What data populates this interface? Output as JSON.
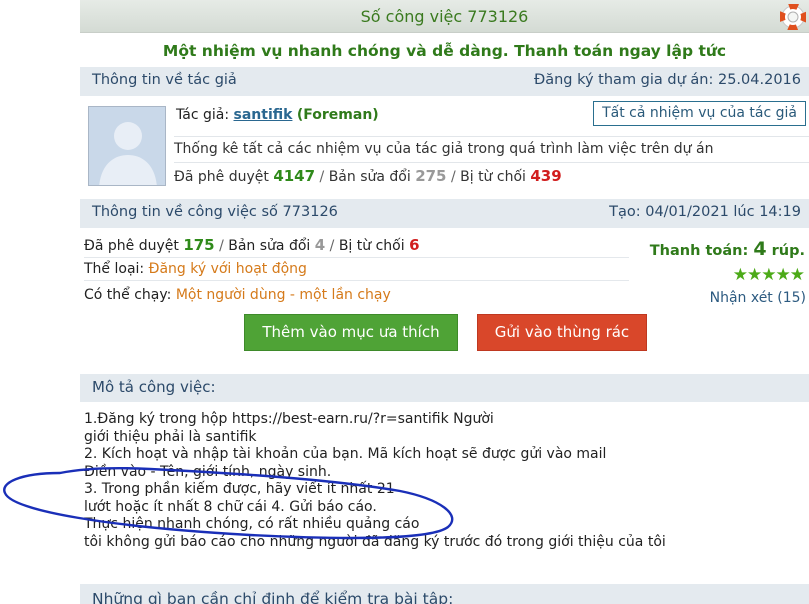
{
  "header": {
    "title": "Số công việc 773126"
  },
  "headline": "Một nhiệm vụ nhanh chóng và dễ dàng. Thanh toán ngay lập tức",
  "author_bar": {
    "left": "Thông tin về tác giả",
    "right": "Đăng ký tham gia dự án: 25.04.2016"
  },
  "author": {
    "label": "Tác giả:",
    "name": "santifik",
    "role": "(Foreman)",
    "all_tasks_button": "Tất cả nhiệm vụ của tác giả",
    "stats_title": "Thống kê tất cả các nhiệm vụ của tác giả trong quá trình làm việc trên dự án",
    "approved_label": "Đã phê duyệt",
    "approved": "4147",
    "revised_label": "Bản sửa đổi",
    "revised": "275",
    "rejected_label": "Bị từ chối",
    "rejected": "439"
  },
  "job_bar": {
    "left": "Thông tin về công việc số 773126",
    "right": "Tạo: 04/01/2021 lúc 14:19"
  },
  "job": {
    "approved_label": "Đã phê duyệt",
    "approved": "175",
    "revised_label": "Bản sửa đổi",
    "revised": "4",
    "rejected_label": "Bị từ chối",
    "rejected": "6",
    "category_label": "Thể loại:",
    "category": "Đăng ký với hoạt động",
    "runs_label": "Có thể chạy:",
    "runs": "Một người dùng - một lần chạy",
    "payment_label": "Thanh toán:",
    "payment_amount": "4",
    "payment_unit": "rúp.",
    "stars": "★★★★★",
    "rating_value": 5,
    "reviews": "Nhận xét (15)"
  },
  "actions": {
    "favorite": "Thêm vào mục ưa thích",
    "trash": "Gửi vào thùng rác"
  },
  "description": {
    "header": "Mô tả công việc:",
    "lines": [
      "1.Đăng ký trong hộp https://best-earn.ru/?r=santifik Người",
      "giới thiệu phải là santifik",
      "2. Kích hoạt và nhập tài khoản của bạn. Mã kích hoạt sẽ được gửi vào mail",
      "Điền vào - Tên, giới tính, ngày sinh.",
      "3. Trong phần kiếm được, hãy viết ít nhất 21",
      "lướt hoặc ít nhất 8 chữ cái 4. Gửi báo cáo.",
      "Thực hiện nhanh chóng, có rất nhiều quảng cáo",
      "tôi không gửi báo cáo cho những người đã đăng ký trước đó trong giới thiệu của tôi"
    ]
  },
  "requirements_header": "Những gì bạn cần chỉ định để kiểm tra bài tập:",
  "colors": {
    "accent_green": "#2f7a1a",
    "button_green": "#4fa336",
    "button_red": "#d9472a",
    "bar_bg": "#e4eaef",
    "scribble": "#1a2fb8"
  }
}
